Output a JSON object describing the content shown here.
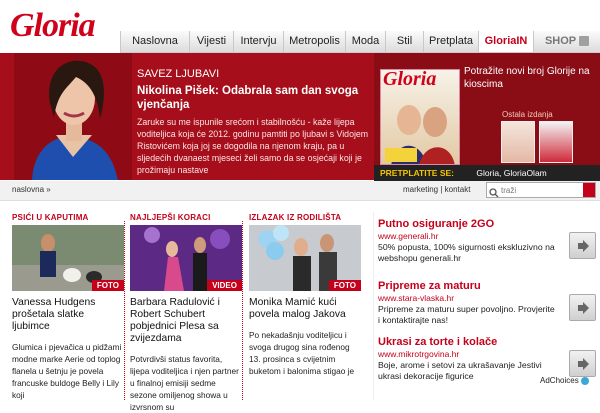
{
  "logo": "Gloria",
  "nav": [
    "Naslovna",
    "Vijesti",
    "Intervju",
    "Metropolis",
    "Moda",
    "Stil",
    "Pretplata",
    "GloriaIN",
    "SHOP"
  ],
  "hero": {
    "kicker": "SAVEZ LJUBAVI",
    "headline": "Nikolina Pišek: Odabrala sam dan svoga vjenčanja",
    "teaser": "Zaruke su me ispunile srećom i stabilnošću - kaže lijepa voditeljica koja će 2012. godinu pamtiti po ljubavi s Vidojem Ristovićem koja joj se dogodila na njenom kraju, pa u sljedećih dvanaest mjeseci želi samo da se osjećaji koji je prožimaju nastave"
  },
  "magazine": {
    "cover_logo": "Gloria",
    "text": "Potražite novi broj Glorije na kioscima",
    "other_issues": "Ostala izdanja",
    "subscribe": "PRETPLATITE SE:",
    "subscribe_links": "Gloria, GloriaOlam"
  },
  "breadcrumb": "naslovna »",
  "util_links": "marketing | kontakt",
  "search_placeholder": "traži",
  "columns": [
    {
      "rubric": "PSIĆI U KAPUTIMA",
      "badge": "FOTO",
      "title": "Vanessa Hudgens prošetala slatke ljubimce",
      "text": "Glumica i pjevačica u pidžami modne marke Aerie od toplog flanela u šetnju je povela francuske buldoge Belly i Lily koji"
    },
    {
      "rubric": "NAJLJEPŠI KORACI",
      "badge": "VIDEO",
      "title": "Barbara Radulović i Robert Schubert pobjednici Plesa sa zvijezdama",
      "text": "Potvrdivši status favorita, lijepa voditeljica i njen partner u finalnoj emisiji sedme sezone omiljenog showa u izvrsnom su"
    },
    {
      "rubric": "IZLAZAK IZ RODILIŠTA",
      "badge": "FOTO",
      "title": "Monika Mamić kući povela malog Jakova",
      "text": "Po nekadašnju voditeljicu i svoga drugog sina rođenog 13. prosinca s cvijetnim buketom i balonima stigao je"
    }
  ],
  "ads": [
    {
      "title": "Putno osiguranje 2GO",
      "url": "www.generali.hr",
      "desc": "50% popusta, 100% sigurnosti ekskluzivno na webshopu generali.hr"
    },
    {
      "title": "Pripreme za maturu",
      "url": "www.stara-vlaska.hr",
      "desc": "Pripreme za maturu super povoljno. Provjerite i kontaktirajte nas!"
    },
    {
      "title": "Ukrasi za torte i kolače",
      "url": "www.mikrotrgovina.hr",
      "desc": "Boje, arome i setovi za ukrašavanje Jestivi ukrasi dekoracije figurice"
    }
  ],
  "adchoices": "AdChoices"
}
